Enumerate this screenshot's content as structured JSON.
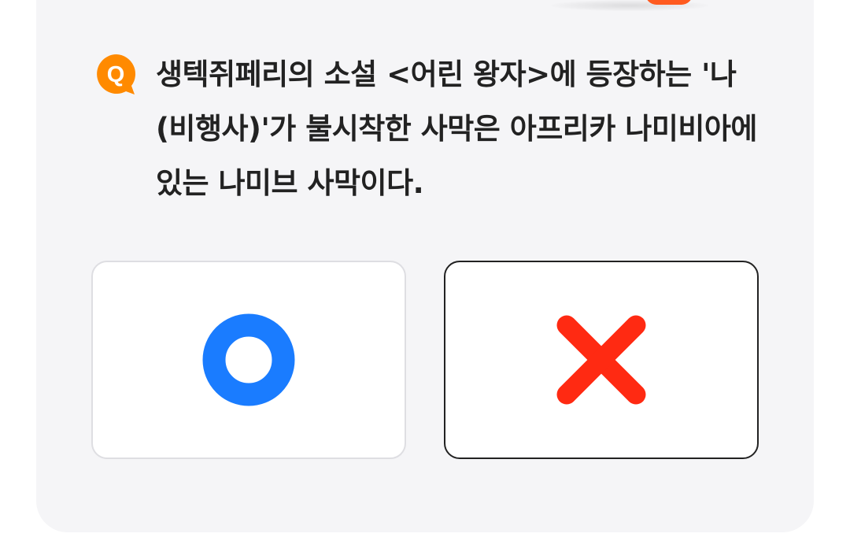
{
  "quiz": {
    "badge_label": "Q",
    "question": "생텍쥐페리의 소설 <어린 왕자>에 등장하는 '나(비행사)'가 불시착한 사막은 아프리카 나미비아에 있는 나미브 사막이다.",
    "options": [
      {
        "id": "o",
        "icon": "circle-o-icon",
        "color": "#1a7cff"
      },
      {
        "id": "x",
        "icon": "cross-x-icon",
        "color": "#ff2a12"
      }
    ]
  },
  "colors": {
    "badge": "#ff8a00",
    "card_background": "#f5f5f7",
    "selected_border": "#222222",
    "unselected_border": "#dedee2",
    "decoration": "#ff5a1f"
  }
}
